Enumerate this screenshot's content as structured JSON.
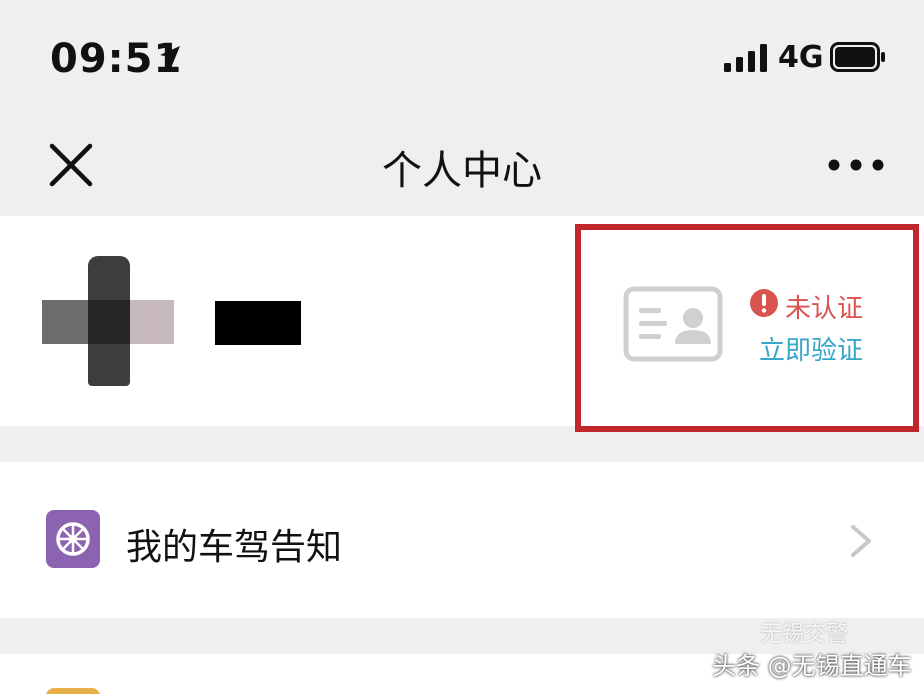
{
  "status_bar": {
    "time": "09:51",
    "network": "4G",
    "icons": [
      "location-arrow-icon",
      "signal-icon",
      "battery-icon"
    ]
  },
  "nav": {
    "title": "个人中心",
    "left_icon": "close-icon",
    "right_icon": "more-icon"
  },
  "profile": {
    "verification": {
      "status": "未认证",
      "action": "立即验证",
      "status_color": "#d9534f",
      "action_color": "#38a6c8",
      "highlight_color": "#c0262b"
    }
  },
  "menu": {
    "items": [
      {
        "label": "我的车驾告知",
        "icon": "wheel-icon",
        "icon_color": "#8c63b0"
      }
    ]
  },
  "watermark": {
    "text": "头条 @无锡直通车",
    "faint_text": "无锡交警"
  }
}
